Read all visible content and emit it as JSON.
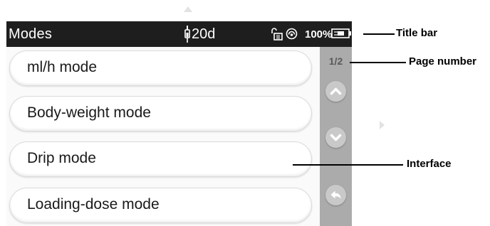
{
  "title_bar": {
    "title": "Modes",
    "syringe_time": "20d",
    "battery_percent": "100%",
    "icons": [
      "syringe-icon",
      "keypad-unlock-icon",
      "sound-icon",
      "battery-plug-icon"
    ]
  },
  "modes": [
    {
      "label": "ml/h mode"
    },
    {
      "label": "Body-weight mode"
    },
    {
      "label": "Drip mode"
    },
    {
      "label": "Loading-dose mode"
    }
  ],
  "side_panel": {
    "page_number": "1/2",
    "buttons": [
      "chevron-up-icon",
      "chevron-down-icon",
      "back-arrow-icon"
    ]
  },
  "annotations": {
    "title_bar": "Title bar",
    "page_number": "Page number",
    "interface": "Interface"
  },
  "colors": {
    "title_bar_bg": "#1e1e1e",
    "side_panel_bg": "#ababab",
    "button_bg": "#c9c9c9"
  }
}
